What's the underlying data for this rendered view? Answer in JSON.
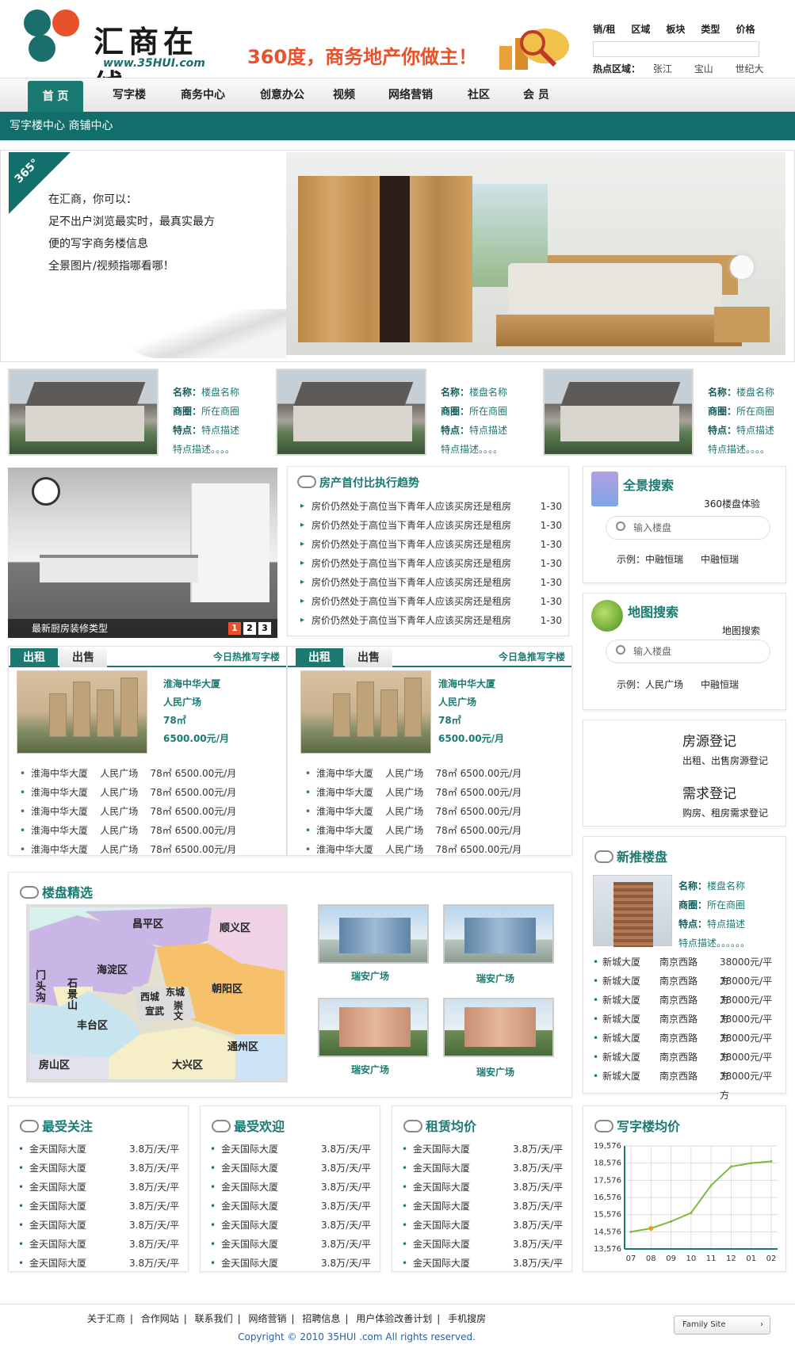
{
  "header": {
    "logo_title": "汇商在线",
    "logo_url": "www.35HUI.com",
    "slogan": "360度，商务地产你做主！",
    "search_tabs": [
      "销/租",
      "区域",
      "板块",
      "类型",
      "价格"
    ],
    "hot_label": "热点区域：",
    "hot_areas": [
      "张江",
      "宝山",
      "世纪大道"
    ]
  },
  "nav": {
    "items": [
      "首 页",
      "写字楼",
      "商务中心",
      "创意办公",
      "视频",
      "网络营销",
      "社区",
      "会 员"
    ],
    "subnav": "写字楼中心  商铺中心"
  },
  "banner": {
    "badge": "365°",
    "lines": [
      "在汇商，你可以：",
      "足不出户浏览最实时，最真实最方",
      "便的写字商务楼信息",
      "全景图片/视频指哪看哪！"
    ]
  },
  "props": [
    {
      "name_label": "名称：",
      "name": "楼盘名称",
      "area_label": "商圈：",
      "area": "所在商圈",
      "feat_label": "特点：",
      "feat": "特点描述",
      "desc": "特点描述。。。。"
    },
    {
      "name_label": "名称：",
      "name": "楼盘名称",
      "area_label": "商圈：",
      "area": "所在商圈",
      "feat_label": "特点：",
      "feat": "特点描述",
      "desc": "特点描述。。。。"
    },
    {
      "name_label": "名称：",
      "name": "楼盘名称",
      "area_label": "商圈：",
      "area": "所在商圈",
      "feat_label": "特点：",
      "feat": "特点描述",
      "desc": "特点描述。。。。"
    }
  ],
  "kitchen": {
    "caption": "最新厨房装修类型",
    "pages": [
      "1",
      "2",
      "3"
    ]
  },
  "trend": {
    "title": "房产首付比执行趋势",
    "items": [
      {
        "text": "房价仍然处于高位当下青年人应该买房还是租房",
        "date": "1-30"
      },
      {
        "text": "房价仍然处于高位当下青年人应该买房还是租房",
        "date": "1-30"
      },
      {
        "text": "房价仍然处于高位当下青年人应该买房还是租房",
        "date": "1-30"
      },
      {
        "text": "房价仍然处于高位当下青年人应该买房还是租房",
        "date": "1-30"
      },
      {
        "text": "房价仍然处于高位当下青年人应该买房还是租房",
        "date": "1-30"
      },
      {
        "text": "房价仍然处于高位当下青年人应该买房还是租房",
        "date": "1-30"
      },
      {
        "text": "房价仍然处于高位当下青年人应该买房还是租房",
        "date": "1-30"
      }
    ]
  },
  "quanjing": {
    "title": "全景搜索",
    "sub": "360楼盘体验",
    "placeholder": "输入楼盘",
    "eg_label": "示例：",
    "eg1": "中融恒瑞",
    "eg2": "中融恒瑞"
  },
  "ditu": {
    "title": "地图搜索",
    "sub": "地图搜索",
    "placeholder": "输入楼盘",
    "eg_label": "示例：",
    "eg1": "人民广场",
    "eg2": "中融恒瑞"
  },
  "register": {
    "source_title": "房源登记",
    "source_sub": "出租、出售房源登记",
    "need_title": "需求登记",
    "need_sub": "购房、租房需求登记"
  },
  "rent_left": {
    "tab_on": "出租",
    "tab_off": "出售",
    "tag": "今日热推写字楼",
    "info": [
      "淮海中华大厦",
      "人民广场",
      "78㎡",
      "6500.00元/月"
    ],
    "rows": [
      "淮海中华大厦    人民广场    78㎡ 6500.00元/月",
      "淮海中华大厦    人民广场    78㎡ 6500.00元/月",
      "淮海中华大厦    人民广场    78㎡ 6500.00元/月",
      "淮海中华大厦    人民广场    78㎡ 6500.00元/月",
      "淮海中华大厦    人民广场    78㎡ 6500.00元/月"
    ]
  },
  "rent_right": {
    "tab_on": "出租",
    "tab_off": "出售",
    "tag": "今日急推写字楼",
    "info": [
      "淮海中华大厦",
      "人民广场",
      "78㎡",
      "6500.00元/月"
    ],
    "rows": [
      "淮海中华大厦    人民广场    78㎡ 6500.00元/月",
      "淮海中华大厦    人民广场    78㎡ 6500.00元/月",
      "淮海中华大厦    人民广场    78㎡ 6500.00元/月",
      "淮海中华大厦    人民广场    78㎡ 6500.00元/月",
      "淮海中华大厦    人民广场    78㎡ 6500.00元/月"
    ]
  },
  "jingxuan": {
    "title": "楼盘精选",
    "zones": [
      "昌平区",
      "顺义区",
      "海淀区",
      "门头沟",
      "石景山",
      "西城",
      "东城",
      "宣武",
      "崇文",
      "朝阳区",
      "丰台区",
      "通州区",
      "房山区",
      "大兴区"
    ],
    "buildings": [
      "瑞安广场",
      "瑞安广场",
      "瑞安广场",
      "瑞安广场"
    ]
  },
  "xintui": {
    "title": "新推楼盘",
    "name_label": "名称：",
    "name": "楼盘名称",
    "area_label": "商圈：",
    "area": "所在商圈",
    "feat_label": "特点：",
    "feat": "特点描述",
    "desc": "特点描述。。。。。。",
    "rows": [
      [
        "新城大厦",
        "南京西路",
        "38000元/平方"
      ],
      [
        "新城大厦",
        "南京西路",
        "38000元/平方"
      ],
      [
        "新城大厦",
        "南京西路",
        "38000元/平方"
      ],
      [
        "新城大厦",
        "南京西路",
        "38000元/平方"
      ],
      [
        "新城大厦",
        "南京西路",
        "38000元/平方"
      ],
      [
        "新城大厦",
        "南京西路",
        "38000元/平方"
      ],
      [
        "新城大厦",
        "南京西路",
        "38000元/平方"
      ]
    ]
  },
  "lists": [
    {
      "title": "最受关注",
      "rows": [
        [
          "金天国际大厦",
          "3.8万/天/平"
        ],
        [
          "金天国际大厦",
          "3.8万/天/平"
        ],
        [
          "金天国际大厦",
          "3.8万/天/平"
        ],
        [
          "金天国际大厦",
          "3.8万/天/平"
        ],
        [
          "金天国际大厦",
          "3.8万/天/平"
        ],
        [
          "金天国际大厦",
          "3.8万/天/平"
        ],
        [
          "金天国际大厦",
          "3.8万/天/平"
        ]
      ]
    },
    {
      "title": "最受欢迎",
      "rows": [
        [
          "金天国际大厦",
          "3.8万/天/平"
        ],
        [
          "金天国际大厦",
          "3.8万/天/平"
        ],
        [
          "金天国际大厦",
          "3.8万/天/平"
        ],
        [
          "金天国际大厦",
          "3.8万/天/平"
        ],
        [
          "金天国际大厦",
          "3.8万/天/平"
        ],
        [
          "金天国际大厦",
          "3.8万/天/平"
        ],
        [
          "金天国际大厦",
          "3.8万/天/平"
        ]
      ]
    },
    {
      "title": "租赁均价",
      "rows": [
        [
          "金天国际大厦",
          "3.8万/天/平"
        ],
        [
          "金天国际大厦",
          "3.8万/天/平"
        ],
        [
          "金天国际大厦",
          "3.8万/天/平"
        ],
        [
          "金天国际大厦",
          "3.8万/天/平"
        ],
        [
          "金天国际大厦",
          "3.8万/天/平"
        ],
        [
          "金天国际大厦",
          "3.8万/天/平"
        ],
        [
          "金天国际大厦",
          "3.8万/天/平"
        ]
      ]
    }
  ],
  "chart_data": {
    "type": "line",
    "title": "写字楼均价",
    "categories": [
      "07",
      "08",
      "09",
      "10",
      "11",
      "12",
      "01",
      "02"
    ],
    "series": [
      {
        "values": [
          14576,
          14776,
          15176,
          15676,
          17276,
          18376,
          18576,
          18676
        ]
      }
    ],
    "yticks": [
      "19,576",
      "18,576",
      "17,576",
      "16,576",
      "15,576",
      "14,576",
      "13,576"
    ],
    "ylim": [
      13576,
      19576
    ],
    "grid": true,
    "line_color": "#7dbb3c",
    "highlight_point_color": "#f39c12"
  },
  "footer": {
    "links": [
      "关于汇商",
      "合作网站",
      "联系我们",
      "网络营销",
      "招聘信息",
      "用户体验改善计划",
      "手机搜房"
    ],
    "copyright": "Copyright © 2010 35HUI .com All rights reserved.",
    "family": "Family Site"
  }
}
